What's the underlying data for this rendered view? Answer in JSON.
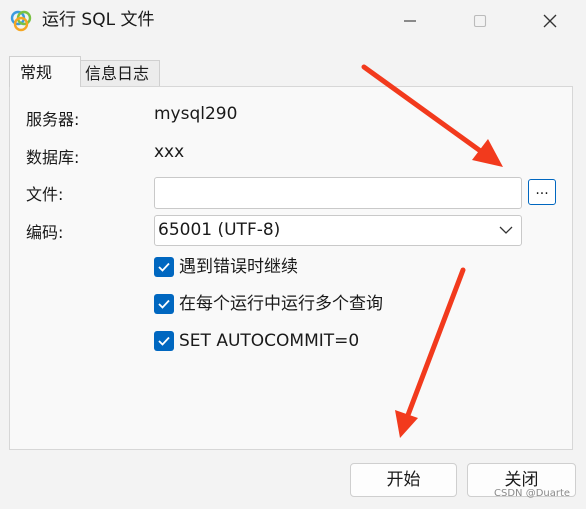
{
  "window": {
    "title": "运行 SQL 文件",
    "icon": "navicat-icon",
    "controls": [
      "minimize-icon",
      "maximize-icon",
      "close-icon"
    ]
  },
  "tabs": [
    {
      "label": "常规",
      "active": true
    },
    {
      "label": "信息日志",
      "active": false
    }
  ],
  "form": {
    "server_label": "服务器:",
    "server_value": "mysql290",
    "database_label": "数据库:",
    "database_value": "xxx",
    "file_label": "文件:",
    "file_value": "",
    "browse_label": "...",
    "encoding_label": "编码:",
    "encoding_value": "65001 (UTF-8)"
  },
  "options": [
    {
      "label": "遇到错误时继续",
      "checked": true
    },
    {
      "label": "在每个运行中运行多个查询",
      "checked": true
    },
    {
      "label": "SET AUTOCOMMIT=0",
      "checked": true
    }
  ],
  "buttons": {
    "start": "开始",
    "close": "关闭"
  },
  "watermark": "CSDN @Duarte",
  "colors": {
    "accent": "#0067c0",
    "annotation_arrow": "#f23a1d"
  }
}
